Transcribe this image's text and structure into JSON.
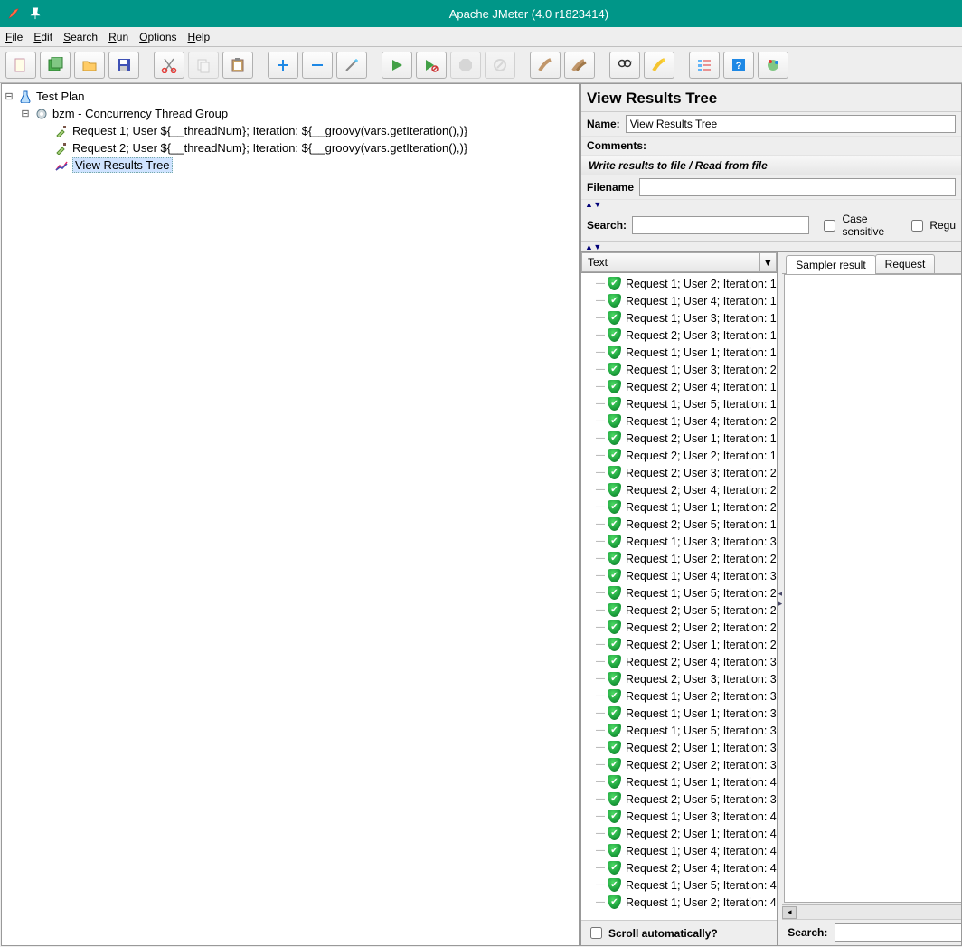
{
  "window": {
    "title": "Apache JMeter (4.0 r1823414)"
  },
  "menu": {
    "items": [
      {
        "key": "F",
        "rest": "ile"
      },
      {
        "key": "E",
        "rest": "dit"
      },
      {
        "key": "S",
        "rest": "earch"
      },
      {
        "key": "R",
        "rest": "un"
      },
      {
        "key": "O",
        "rest": "ptions"
      },
      {
        "key": "H",
        "rest": "elp"
      }
    ]
  },
  "tree": {
    "root_label": "Test Plan",
    "group_label": "bzm - Concurrency Thread Group",
    "req1": "Request 1; User ${__threadNum}; Iteration: ${__groovy(vars.getIteration(),)}",
    "req2": "Request 2; User ${__threadNum}; Iteration: ${__groovy(vars.getIteration(),)}",
    "listener": "View Results Tree"
  },
  "panel": {
    "title": "View Results Tree",
    "name_label": "Name:",
    "name_value": "View Results Tree",
    "comments_label": "Comments:",
    "writefile_header": "Write results to file / Read from file",
    "filename_label": "Filename",
    "filename_value": "",
    "search_label": "Search:",
    "search_value": "",
    "case_sensitive": "Case sensitive",
    "regex": "Regu",
    "dropdown_value": "Text",
    "tabs": {
      "sampler": "Sampler result",
      "request": "Request"
    },
    "scroll_auto": "Scroll automatically?",
    "bottom_search_label": "Search:",
    "bottom_search_value": ""
  },
  "results": [
    "Request 1; User 2; Iteration: 1",
    "Request 1; User 4; Iteration: 1",
    "Request 1; User 3; Iteration: 1",
    "Request 2; User 3; Iteration: 1",
    "Request 1; User 1; Iteration: 1",
    "Request 1; User 3; Iteration: 2",
    "Request 2; User 4; Iteration: 1",
    "Request 1; User 5; Iteration: 1",
    "Request 1; User 4; Iteration: 2",
    "Request 2; User 1; Iteration: 1",
    "Request 2; User 2; Iteration: 1",
    "Request 2; User 3; Iteration: 2",
    "Request 2; User 4; Iteration: 2",
    "Request 1; User 1; Iteration: 2",
    "Request 2; User 5; Iteration: 1",
    "Request 1; User 3; Iteration: 3",
    "Request 1; User 2; Iteration: 2",
    "Request 1; User 4; Iteration: 3",
    "Request 1; User 5; Iteration: 2",
    "Request 2; User 5; Iteration: 2",
    "Request 2; User 2; Iteration: 2",
    "Request 2; User 1; Iteration: 2",
    "Request 2; User 4; Iteration: 3",
    "Request 2; User 3; Iteration: 3",
    "Request 1; User 2; Iteration: 3",
    "Request 1; User 1; Iteration: 3",
    "Request 1; User 5; Iteration: 3",
    "Request 2; User 1; Iteration: 3",
    "Request 2; User 2; Iteration: 3",
    "Request 1; User 1; Iteration: 4",
    "Request 2; User 5; Iteration: 3",
    "Request 1; User 3; Iteration: 4",
    "Request 2; User 1; Iteration: 4",
    "Request 1; User 4; Iteration: 4",
    "Request 2; User 4; Iteration: 4",
    "Request 1; User 5; Iteration: 4",
    "Request 1; User 2; Iteration: 4"
  ]
}
